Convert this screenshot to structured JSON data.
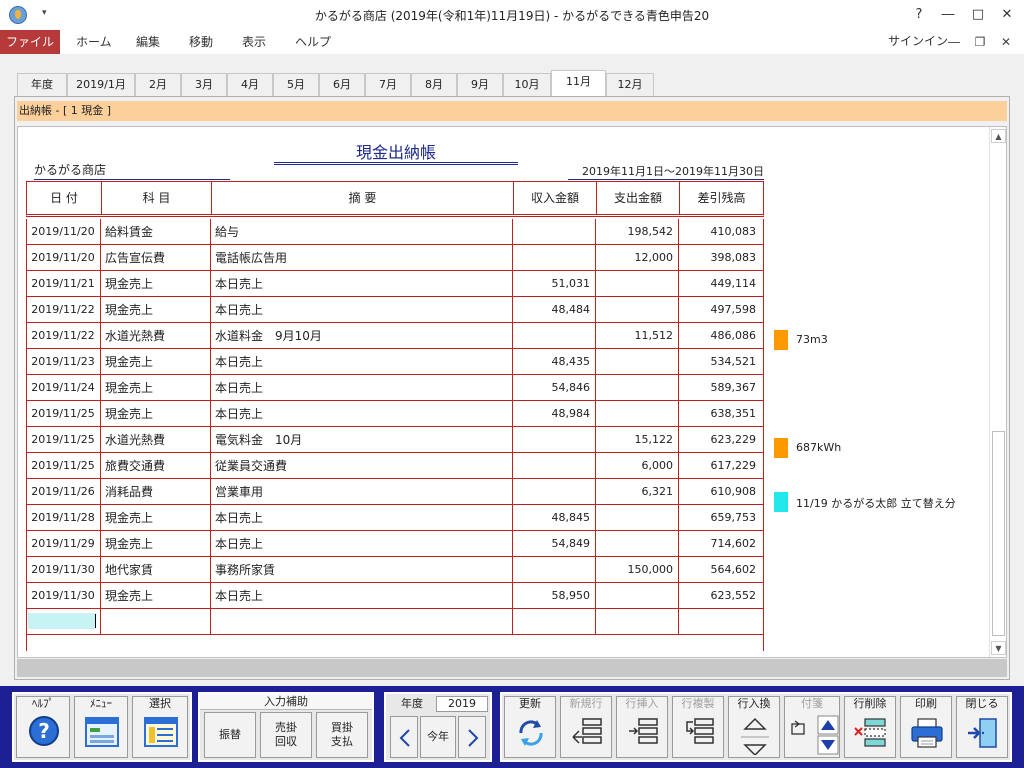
{
  "window": {
    "title": "かるがる商店 (2019年(令和1年)11月19日) - かるがるできる青色申告20",
    "help_icon": "?",
    "minimize_icon": "―",
    "maximize_icon": "□",
    "close_icon": "✕"
  },
  "menu": {
    "items": [
      "ファイル",
      "ホーム",
      "編集",
      "移動",
      "表示",
      "ヘルプ"
    ],
    "signin": "サインイン",
    "min_icon": "―",
    "restore_icon": "❐",
    "close_icon": "✕"
  },
  "tabs": [
    "年度",
    "2019/1月",
    "2月",
    "3月",
    "4月",
    "5月",
    "6月",
    "7月",
    "8月",
    "9月",
    "10月",
    "11月",
    "12月"
  ],
  "active_tab": "11月",
  "ledger": {
    "header": "出納帳 - [ 1 現金 ]",
    "title": "現金出納帳",
    "company": "かるがる商店",
    "period": "2019年11月1日～2019年11月30日",
    "columns": [
      "日 付",
      "科 目",
      "摘 要",
      "収入金額",
      "支出金額",
      "差引残高"
    ],
    "rows": [
      {
        "date": "2019/11/20",
        "account": "給料賃金",
        "desc": "給与",
        "in": "",
        "out": "198,542",
        "bal": "410,083"
      },
      {
        "date": "2019/11/20",
        "account": "広告宣伝費",
        "desc": "電話帳広告用",
        "in": "",
        "out": "12,000",
        "bal": "398,083"
      },
      {
        "date": "2019/11/21",
        "account": "現金売上",
        "desc": "本日売上",
        "in": "51,031",
        "out": "",
        "bal": "449,114"
      },
      {
        "date": "2019/11/22",
        "account": "現金売上",
        "desc": "本日売上",
        "in": "48,484",
        "out": "",
        "bal": "497,598"
      },
      {
        "date": "2019/11/22",
        "account": "水道光熱費",
        "desc": "水道料金　9月10月",
        "in": "",
        "out": "11,512",
        "bal": "486,086",
        "note": "73m3",
        "note_color": "#ff9900"
      },
      {
        "date": "2019/11/23",
        "account": "現金売上",
        "desc": "本日売上",
        "in": "48,435",
        "out": "",
        "bal": "534,521"
      },
      {
        "date": "2019/11/24",
        "account": "現金売上",
        "desc": "本日売上",
        "in": "54,846",
        "out": "",
        "bal": "589,367"
      },
      {
        "date": "2019/11/25",
        "account": "現金売上",
        "desc": "本日売上",
        "in": "48,984",
        "out": "",
        "bal": "638,351"
      },
      {
        "date": "2019/11/25",
        "account": "水道光熱費",
        "desc": "電気料金　10月",
        "in": "",
        "out": "15,122",
        "bal": "623,229",
        "note": "687kWh",
        "note_color": "#ff9900"
      },
      {
        "date": "2019/11/25",
        "account": "旅費交通費",
        "desc": "従業員交通費",
        "in": "",
        "out": "6,000",
        "bal": "617,229"
      },
      {
        "date": "2019/11/26",
        "account": "消耗品費",
        "desc": "営業車用",
        "in": "",
        "out": "6,321",
        "bal": "610,908",
        "note": "11/19 かるがる太郎 立て替え分",
        "note_color": "#22e8ee"
      },
      {
        "date": "2019/11/28",
        "account": "現金売上",
        "desc": "本日売上",
        "in": "48,845",
        "out": "",
        "bal": "659,753"
      },
      {
        "date": "2019/11/29",
        "account": "現金売上",
        "desc": "本日売上",
        "in": "54,849",
        "out": "",
        "bal": "714,602"
      },
      {
        "date": "2019/11/30",
        "account": "地代家賃",
        "desc": "事務所家賃",
        "in": "",
        "out": "150,000",
        "bal": "564,602"
      },
      {
        "date": "2019/11/30",
        "account": "現金売上",
        "desc": "本日売上",
        "in": "58,950",
        "out": "",
        "bal": "623,552"
      }
    ]
  },
  "toolbar": {
    "help": "ﾍﾙﾌﾟ",
    "menu": "ﾒﾆｭｰ",
    "select": "選択",
    "input_assist": "入力補助",
    "furikae": "振替",
    "urikake_1": "売掛",
    "urikake_2": "回収",
    "kaikake_1": "買掛",
    "kaikake_2": "支払",
    "year_label": "年度",
    "year_value": "2019",
    "this_year": "今年",
    "update": "更新",
    "new_row": "新規行",
    "insert_row": "行挿入",
    "copy_row": "行複製",
    "swap_row": "行入換",
    "memo": "付箋",
    "delete_row": "行削除",
    "print": "印刷",
    "close": "閉じる",
    "prev_icon": "chevron-left-icon",
    "next_icon": "chevron-right-icon"
  }
}
